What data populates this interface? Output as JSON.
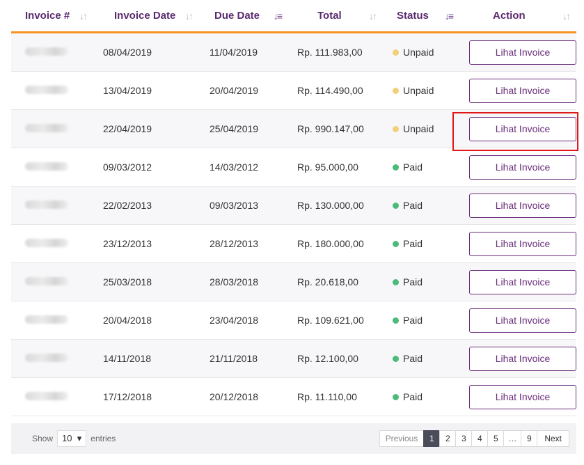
{
  "columns": {
    "invoice_no": "Invoice #",
    "invoice_date": "Invoice Date",
    "due_date": "Due Date",
    "total": "Total",
    "status": "Status",
    "action": "Action"
  },
  "rows": [
    {
      "invoice_date": "08/04/2019",
      "due_date": "11/04/2019",
      "total": "Rp. 111.983,00",
      "status": "Unpaid",
      "action": "Lihat Invoice"
    },
    {
      "invoice_date": "13/04/2019",
      "due_date": "20/04/2019",
      "total": "Rp. 114.490,00",
      "status": "Unpaid",
      "action": "Lihat Invoice"
    },
    {
      "invoice_date": "22/04/2019",
      "due_date": "25/04/2019",
      "total": "Rp. 990.147,00",
      "status": "Unpaid",
      "action": "Lihat Invoice"
    },
    {
      "invoice_date": "09/03/2012",
      "due_date": "14/03/2012",
      "total": "Rp. 95.000,00",
      "status": "Paid",
      "action": "Lihat Invoice"
    },
    {
      "invoice_date": "22/02/2013",
      "due_date": "09/03/2013",
      "total": "Rp. 130.000,00",
      "status": "Paid",
      "action": "Lihat Invoice"
    },
    {
      "invoice_date": "23/12/2013",
      "due_date": "28/12/2013",
      "total": "Rp. 180.000,00",
      "status": "Paid",
      "action": "Lihat Invoice"
    },
    {
      "invoice_date": "25/03/2018",
      "due_date": "28/03/2018",
      "total": "Rp. 20.618,00",
      "status": "Paid",
      "action": "Lihat Invoice"
    },
    {
      "invoice_date": "20/04/2018",
      "due_date": "23/04/2018",
      "total": "Rp. 109.621,00",
      "status": "Paid",
      "action": "Lihat Invoice"
    },
    {
      "invoice_date": "14/11/2018",
      "due_date": "21/11/2018",
      "total": "Rp. 12.100,00",
      "status": "Paid",
      "action": "Lihat Invoice"
    },
    {
      "invoice_date": "17/12/2018",
      "due_date": "20/12/2018",
      "total": "Rp. 11.110,00",
      "status": "Paid",
      "action": "Lihat Invoice"
    }
  ],
  "footer": {
    "show_label": "Show",
    "entries_value": "10",
    "entries_label": "entries",
    "pagination": {
      "previous": "Previous",
      "pages": [
        "1",
        "2",
        "3",
        "4",
        "5",
        "…",
        "9"
      ],
      "next": "Next"
    }
  },
  "colors": {
    "accent_orange": "#f7931e",
    "brand_purple": "#6b2d7c",
    "unpaid_dot": "#f3cf7a",
    "paid_dot": "#4cbb7a",
    "highlight_red": "#e0161b"
  },
  "icons": {
    "sort_neutral": "sort-arrows-icon",
    "sort_asc_active": "sort-asc-icon",
    "sort_desc_active": "sort-desc-icon",
    "dropdown": "chevron-down-icon"
  }
}
